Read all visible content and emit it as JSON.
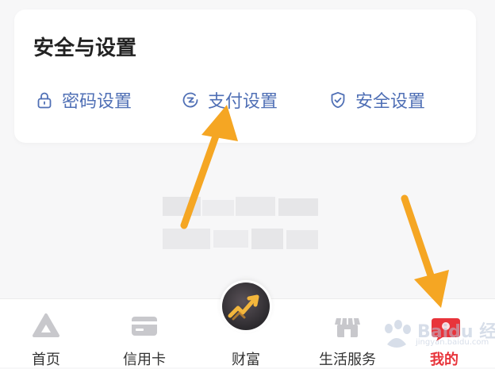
{
  "security_section": {
    "title": "安全与设置",
    "items": [
      {
        "label": "密码设置",
        "icon": "lock-icon"
      },
      {
        "label": "支付设置",
        "icon": "payment-icon"
      },
      {
        "label": "安全设置",
        "icon": "shield-check-icon"
      }
    ]
  },
  "tabbar": {
    "tabs": [
      {
        "label": "首页",
        "icon": "home-triangle-icon"
      },
      {
        "label": "信用卡",
        "icon": "credit-card-icon"
      },
      {
        "label": "财富",
        "icon": "wealth-growth-icon"
      },
      {
        "label": "生活服务",
        "icon": "store-icon"
      },
      {
        "label": "我的",
        "icon": "user-badge-icon",
        "active": true
      }
    ]
  },
  "watermark": {
    "brand": "Baidu 经验",
    "sub": "jingyan.baidu.com"
  },
  "colors": {
    "link_blue": "#4f6fb5",
    "active_red": "#e8343b",
    "arrow_orange": "#f5a623",
    "icon_gray": "#c8c8cc"
  }
}
